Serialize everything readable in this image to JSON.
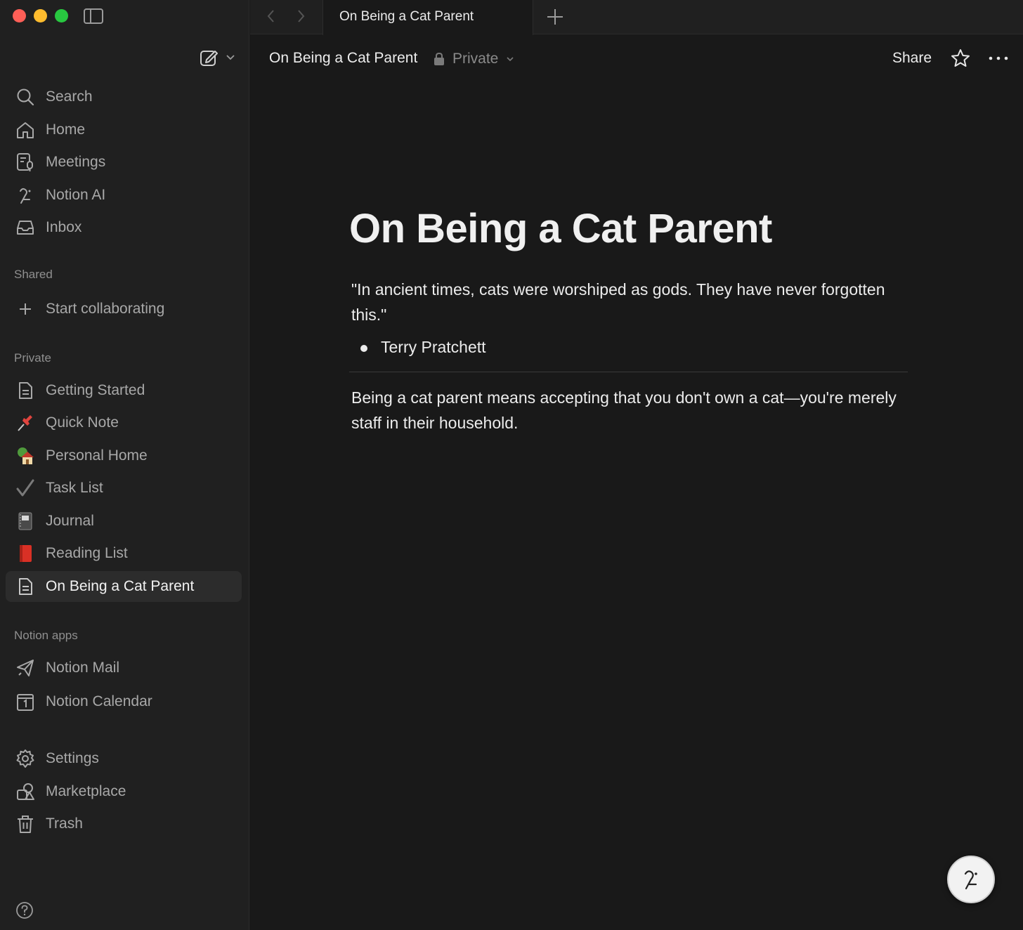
{
  "tab": {
    "title": "On Being a Cat Parent"
  },
  "topbar": {
    "breadcrumb": "On Being a Cat Parent",
    "privacy": "Private",
    "share_label": "Share"
  },
  "sidebar": {
    "main_items": [
      {
        "label": "Search",
        "icon": "search-icon"
      },
      {
        "label": "Home",
        "icon": "home-icon"
      },
      {
        "label": "Meetings",
        "icon": "meetings-icon"
      },
      {
        "label": "Notion AI",
        "icon": "notion-ai-icon"
      },
      {
        "label": "Inbox",
        "icon": "inbox-icon"
      }
    ],
    "shared_label": "Shared",
    "shared_items": [
      {
        "label": "Start collaborating",
        "icon": "plus-icon"
      }
    ],
    "private_label": "Private",
    "private_items": [
      {
        "label": "Getting Started",
        "icon": "page-icon"
      },
      {
        "label": "Quick Note",
        "icon": "pushpin-icon"
      },
      {
        "label": "Personal Home",
        "icon": "house-icon"
      },
      {
        "label": "Task List",
        "icon": "checkmark-icon"
      },
      {
        "label": "Journal",
        "icon": "notebook-icon"
      },
      {
        "label": "Reading List",
        "icon": "red-book-icon"
      },
      {
        "label": "On Being a Cat Parent",
        "icon": "page-icon",
        "active": true
      }
    ],
    "apps_label": "Notion apps",
    "apps_items": [
      {
        "label": "Notion Mail",
        "icon": "mail-icon"
      },
      {
        "label": "Notion Calendar",
        "icon": "calendar-icon"
      }
    ],
    "bottom_items": [
      {
        "label": "Settings",
        "icon": "gear-icon"
      },
      {
        "label": "Marketplace",
        "icon": "marketplace-icon"
      },
      {
        "label": "Trash",
        "icon": "trash-icon"
      }
    ]
  },
  "document": {
    "title": "On Being a Cat Parent",
    "quote": "\"In ancient times, cats were worshiped as gods. They have never forgotten this.\"",
    "attribution": "Terry Pratchett",
    "paragraph": "Being a cat parent means accepting that you don't own a cat—you're merely staff in their household."
  },
  "colors": {
    "background": "#191919",
    "sidebar": "#202020",
    "text": "#ececec",
    "muted": "#a8a8a8"
  }
}
